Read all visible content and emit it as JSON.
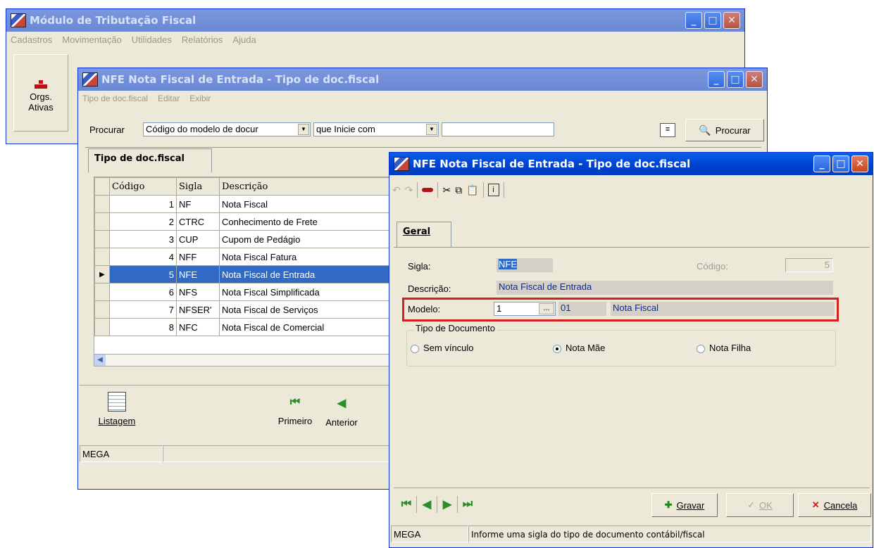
{
  "main_window": {
    "title": "Módulo de Tributação Fiscal",
    "menu": [
      "Cadastros",
      "Movimentação",
      "Utilidades",
      "Relatórios",
      "Ajuda"
    ],
    "sidebar_button_label_1": "Orgs.",
    "sidebar_button_label_2": "Ativas"
  },
  "list_window": {
    "title": "NFE Nota Fiscal de Entrada -  Tipo de doc.fiscal",
    "menu": [
      "Tipo de doc.fiscal",
      "Editar",
      "Exibir"
    ],
    "search_label": "Procurar",
    "search_field_value": "Código do modelo de docur",
    "search_mode_value": "que Inicie com",
    "search_text_value": "",
    "search_button_label": "Procurar",
    "tab_label": "Tipo de doc.fiscal",
    "columns": [
      "Código",
      "Sigla",
      "Descrição"
    ],
    "rows": [
      {
        "codigo": "1",
        "sigla": "NF",
        "descricao": "Nota Fiscal"
      },
      {
        "codigo": "2",
        "sigla": "CTRC",
        "descricao": "Conhecimento de Frete"
      },
      {
        "codigo": "3",
        "sigla": "CUP",
        "descricao": "Cupom de Pedágio"
      },
      {
        "codigo": "4",
        "sigla": "NFF",
        "descricao": "Nota Fiscal Fatura"
      },
      {
        "codigo": "5",
        "sigla": "NFE",
        "descricao": "Nota Fiscal de Entrada"
      },
      {
        "codigo": "6",
        "sigla": "NFS",
        "descricao": "Nota Fiscal Simplificada"
      },
      {
        "codigo": "7",
        "sigla": "NFSER'",
        "descricao": "Nota Fiscal de Serviços"
      },
      {
        "codigo": "8",
        "sigla": "NFC",
        "descricao": "Nota Fiscal de Comercial"
      }
    ],
    "selected_row_index": 4,
    "listagem_label": "Listagem",
    "primeiro_label": "Primeiro",
    "anterior_label": "Anterior",
    "status_text": "MEGA"
  },
  "edit_window": {
    "title": "NFE Nota Fiscal de Entrada -  Tipo de doc.fiscal",
    "tab_label": "Geral",
    "sigla_label": "Sigla:",
    "sigla_value": "NFE",
    "codigo_label": "Código:",
    "codigo_value": "5",
    "descricao_label": "Descrição:",
    "descricao_value": "Nota Fiscal de Entrada",
    "modelo_label": "Modelo:",
    "modelo_value": "1",
    "modelo_code": "01",
    "modelo_desc": "Nota Fiscal",
    "ellipsis": "...",
    "tipo_group_label": "Tipo de Documento",
    "radio_sem_vinculo": "Sem vínculo",
    "radio_nota_mae": "Nota Mãe",
    "radio_nota_filha": "Nota Filha",
    "selected_radio": "Nota Mãe",
    "gravar_label": "Gravar",
    "ok_label": "OK",
    "cancela_label": "Cancela",
    "status_left": "MEGA",
    "status_message": "Informe uma sigla do tipo de documento contábil/fiscal",
    "highlight_color": "#d42020"
  }
}
